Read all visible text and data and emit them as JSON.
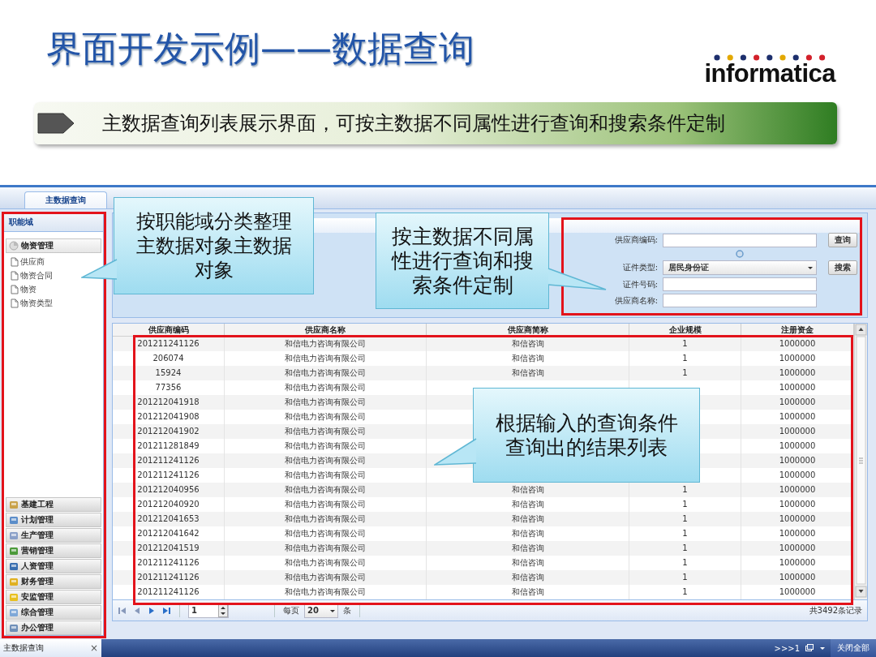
{
  "slide": {
    "title": "界面开发示例——数据查询",
    "logo": "informatica",
    "banner": "主数据查询列表展示界面，可按主数据不同属性进行查询和搜索条件定制"
  },
  "app": {
    "tabs": [
      {
        "label": "主数据查询",
        "selected": true
      }
    ],
    "sidebar": {
      "title": "职能域",
      "groups": [
        {
          "label": "物资管理",
          "expanded": true,
          "children": [
            {
              "label": "供应商"
            },
            {
              "label": "物资合同"
            },
            {
              "label": "物资"
            },
            {
              "label": "物资类型"
            }
          ]
        },
        {
          "label": "基建工程",
          "expanded": false
        },
        {
          "label": "计划管理",
          "expanded": false
        },
        {
          "label": "生产管理",
          "expanded": false
        },
        {
          "label": "营销管理",
          "expanded": false
        },
        {
          "label": "人资管理",
          "expanded": false
        },
        {
          "label": "财务管理",
          "expanded": false
        },
        {
          "label": "安监管理",
          "expanded": false
        },
        {
          "label": "综合管理",
          "expanded": false
        },
        {
          "label": "办公管理",
          "expanded": false
        }
      ]
    },
    "form": {
      "fields": [
        {
          "label": "供应商编码:",
          "kind": "text"
        },
        {
          "label": "证件类型:",
          "kind": "select",
          "value": "居民身份证"
        },
        {
          "label": "证件号码:",
          "kind": "text"
        },
        {
          "label": "供应商名称:",
          "kind": "text"
        }
      ],
      "buttons": [
        "查询",
        "搜索"
      ]
    },
    "table": {
      "columns": [
        "供应商编码",
        "供应商名称",
        "供应商简称",
        "企业规模",
        "注册资金"
      ],
      "rows": [
        {
          "code": "201211241126",
          "name": "和信电力咨询有限公司",
          "short": "和信咨询",
          "scale": "1",
          "capital": "1000000"
        },
        {
          "code": "206074",
          "name": "和信电力咨询有限公司",
          "short": "和信咨询",
          "scale": "1",
          "capital": "1000000"
        },
        {
          "code": "15924",
          "name": "和信电力咨询有限公司",
          "short": "和信咨询",
          "scale": "1",
          "capital": "1000000"
        },
        {
          "code": "77356",
          "name": "和信电力咨询有限公司",
          "capital": "1000000"
        },
        {
          "code": "201212041918",
          "name": "和信电力咨询有限公司",
          "capital": "1000000"
        },
        {
          "code": "201212041908",
          "name": "和信电力咨询有限公司",
          "capital": "1000000"
        },
        {
          "code": "201212041902",
          "name": "和信电力咨询有限公司",
          "capital": "1000000"
        },
        {
          "code": "201211281849",
          "name": "和信电力咨询有限公司",
          "capital": "1000000"
        },
        {
          "code": "201211241126",
          "name": "和信电力咨询有限公司",
          "capital": "1000000"
        },
        {
          "code": "201211241126",
          "name": "和信电力咨询有限公司",
          "capital": "1000000"
        },
        {
          "code": "201212040956",
          "name": "和信电力咨询有限公司",
          "short": "和信咨询",
          "scale": "1",
          "capital": "1000000"
        },
        {
          "code": "201212040920",
          "name": "和信电力咨询有限公司",
          "short": "和信咨询",
          "scale": "1",
          "capital": "1000000"
        },
        {
          "code": "201212041653",
          "name": "和信电力咨询有限公司",
          "short": "和信咨询",
          "scale": "1",
          "capital": "1000000"
        },
        {
          "code": "201212041642",
          "name": "和信电力咨询有限公司",
          "short": "和信咨询",
          "scale": "1",
          "capital": "1000000"
        },
        {
          "code": "201212041519",
          "name": "和信电力咨询有限公司",
          "short": "和信咨询",
          "scale": "1",
          "capital": "1000000"
        },
        {
          "code": "201211241126",
          "name": "和信电力咨询有限公司",
          "short": "和信咨询",
          "scale": "1",
          "capital": "1000000"
        },
        {
          "code": "201211241126",
          "name": "和信电力咨询有限公司",
          "short": "和信咨询",
          "scale": "1",
          "capital": "1000000"
        },
        {
          "code": "201211241126",
          "name": "和信电力咨询有限公司",
          "short": "和信咨询",
          "scale": "1",
          "capital": "1000000"
        }
      ]
    },
    "pager": {
      "page": "1",
      "per_page_label": "每页",
      "per_page": "20",
      "unit": "条",
      "total": "共3492条记录"
    },
    "taskbar": {
      "tabs": [
        {
          "label": "主数据查询",
          "selected": true,
          "close": "×"
        }
      ],
      "window_count": ">>>1",
      "close_all": "关闭全部"
    }
  },
  "callouts": [
    {
      "text": "按职能域分类整理主数据对象主数据对象"
    },
    {
      "text": "按主数据不同属性进行查询和搜索条件定制"
    },
    {
      "text": "根据输入的查询条件查询出的结果列表"
    }
  ]
}
